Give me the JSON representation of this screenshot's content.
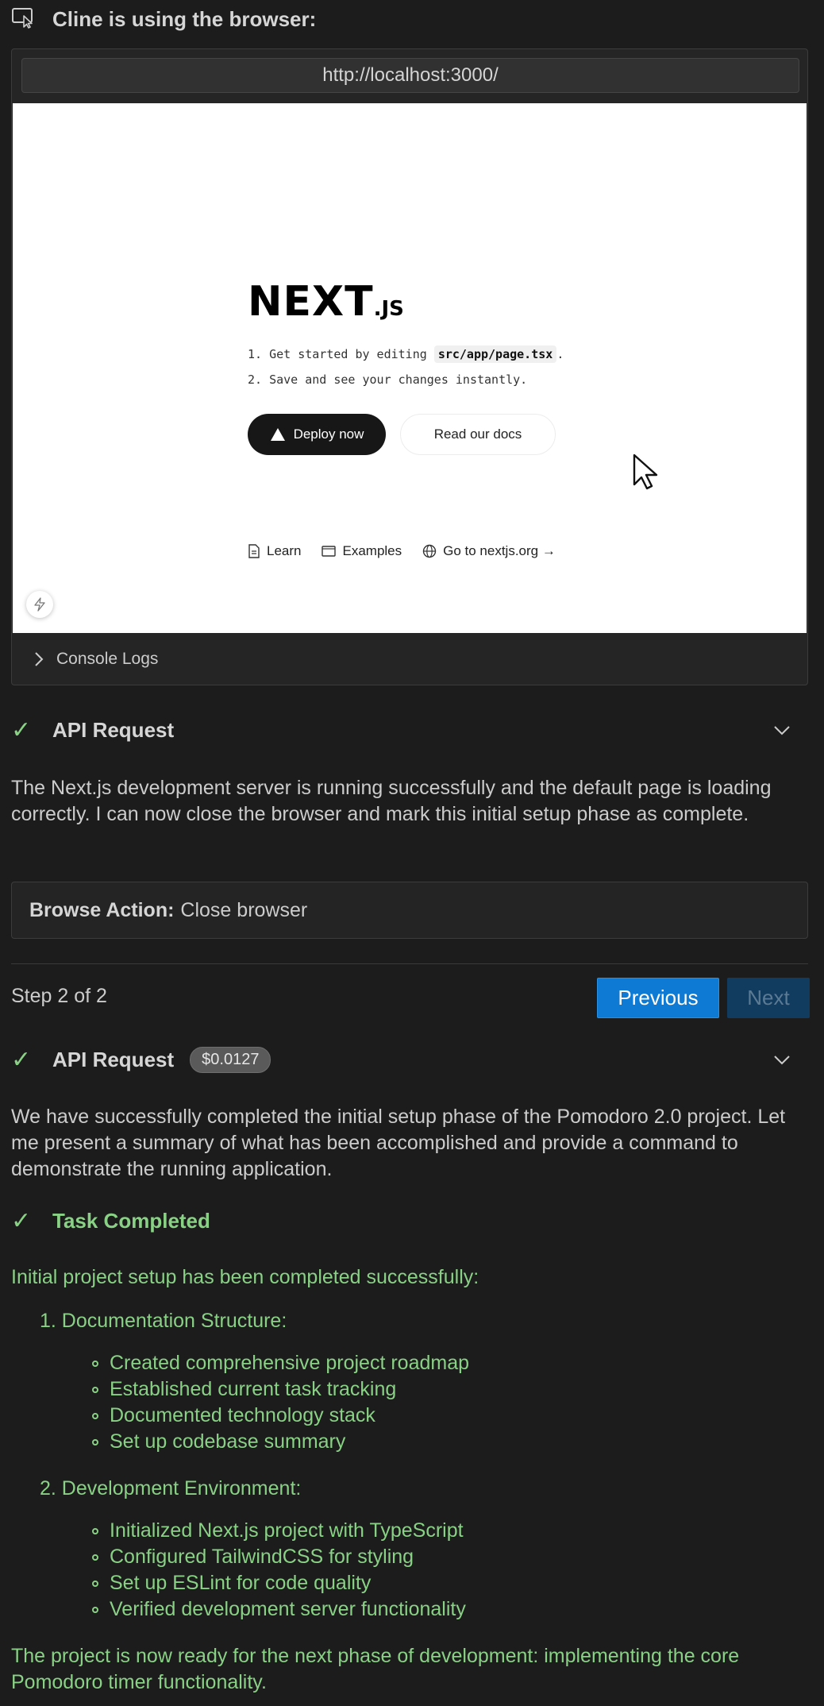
{
  "header": {
    "title": "Cline is using the browser:"
  },
  "browser": {
    "url": "http://localhost:3000/",
    "page": {
      "logo": "NEXT",
      "logo_suffix": ".JS",
      "step1_prefix": "1. Get started by editing ",
      "step1_code": "src/app/page.tsx",
      "step1_suffix": ".",
      "step2": "2. Save and see your changes instantly.",
      "deploy_label": "Deploy now",
      "docs_label": "Read our docs",
      "footer": {
        "learn": "Learn",
        "examples": "Examples",
        "goto": "Go to nextjs.org →"
      }
    },
    "console_label": "Console Logs"
  },
  "request1": {
    "title": "API Request",
    "text": "The Next.js development server is running successfully and the default page is loading correctly. I can now close the browser and mark this initial setup phase as complete."
  },
  "browse_action": {
    "label": "Browse Action:",
    "value": "Close browser"
  },
  "pager": {
    "step": "Step 2 of 2",
    "previous": "Previous",
    "next": "Next"
  },
  "request2": {
    "title": "API Request",
    "cost": "$0.0127",
    "text": "We have successfully completed the initial setup phase of the Pomodoro 2.0 project. Let me present a summary of what has been accomplished and provide a command to demonstrate the running application."
  },
  "task": {
    "title": "Task Completed",
    "intro": "Initial project setup has been completed successfully:",
    "sections": [
      {
        "heading": "1. Documentation Structure:",
        "items": [
          "Created comprehensive project roadmap",
          "Established current task tracking",
          "Documented technology stack",
          "Set up codebase summary"
        ]
      },
      {
        "heading": "2. Development Environment:",
        "items": [
          "Initialized Next.js project with TypeScript",
          "Configured TailwindCSS for styling",
          "Set up ESLint for code quality",
          "Verified development server functionality"
        ]
      }
    ],
    "outro": "The project is now ready for the next phase of development: implementing the core Pomodoro timer functionality."
  },
  "colors": {
    "accent": "#0e7ad4",
    "success": "#89d185",
    "background": "#1c1c1c"
  }
}
